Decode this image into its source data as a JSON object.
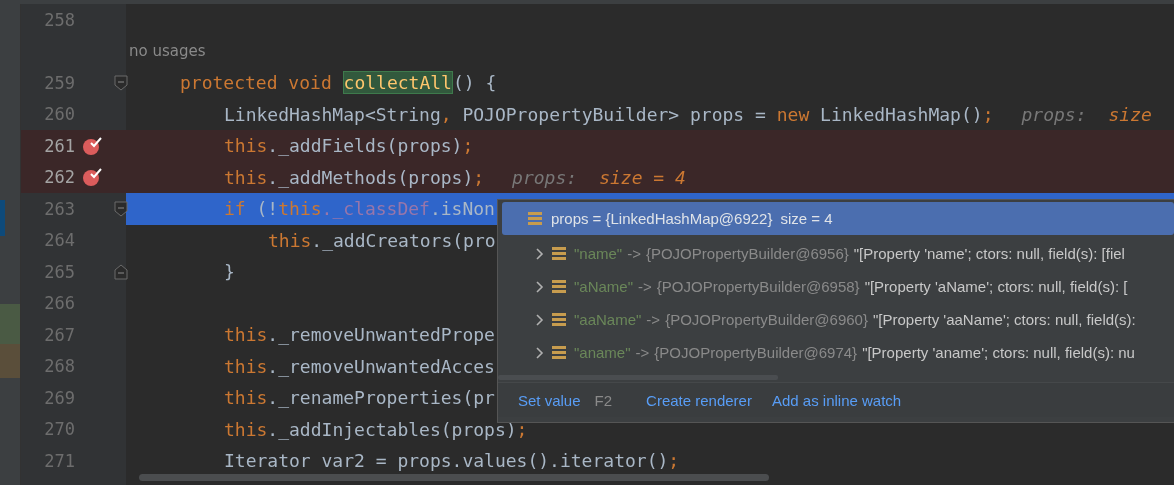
{
  "lines": [
    {
      "number": "258"
    },
    {
      "kind": "usage-hint",
      "text": "no usages"
    },
    {
      "number": "259",
      "fold_start": true,
      "tokens": [
        {
          "kind": "kw",
          "s": "protected void "
        },
        {
          "kind": "match",
          "s": "collectAll"
        },
        {
          "kind": "plain",
          "s": "() {"
        }
      ],
      "children": [
        {
          "number": "260",
          "tokens": [
            {
              "kind": "plain",
              "s": "LinkedHashMap<String"
            },
            {
              "kind": "kw",
              "s": ", "
            },
            {
              "kind": "plain",
              "s": "POJOPropertyBuilder> props = "
            },
            {
              "kind": "kw",
              "s": "new "
            },
            {
              "kind": "plain",
              "s": "LinkedHashMap()"
            },
            {
              "kind": "kw",
              "s": ";"
            },
            {
              "kind": "hint",
              "s": "props:"
            },
            {
              "kind": "hint-value",
              "s": "size"
            }
          ]
        },
        {
          "number": "261",
          "breakpoint": true,
          "tokens": [
            {
              "kind": "kw",
              "s": "this"
            },
            {
              "kind": "plain",
              "s": "._addFields(props)"
            },
            {
              "kind": "kw",
              "s": ";"
            }
          ]
        },
        {
          "number": "262",
          "breakpoint": true,
          "tokens": [
            {
              "kind": "kw",
              "s": "this"
            },
            {
              "kind": "plain",
              "s": "._addMethods(props)"
            },
            {
              "kind": "kw",
              "s": ";"
            },
            {
              "kind": "hint",
              "s": "props:"
            },
            {
              "kind": "hint-value",
              "s": "size = 4"
            }
          ]
        },
        {
          "number": "263",
          "current": true,
          "fold_start": true,
          "tokens": [
            {
              "kind": "kw",
              "s": "if "
            },
            {
              "kind": "plain",
              "s": "(!"
            },
            {
              "kind": "kw",
              "s": "this"
            },
            {
              "kind": "field",
              "s": "._classDef"
            },
            {
              "kind": "plain",
              "s": ".isNon"
            }
          ],
          "children": [
            {
              "number": "264",
              "tokens": [
                {
                  "kind": "kw",
                  "s": "this"
                },
                {
                  "kind": "plain",
                  "s": "._addCreators(pro"
                }
              ]
            }
          ]
        },
        {
          "number": "265",
          "fold_end": true,
          "tokens": [
            {
              "kind": "plain",
              "s": "}"
            }
          ]
        },
        {
          "number": "266"
        },
        {
          "number": "267",
          "tokens": [
            {
              "kind": "kw",
              "s": "this"
            },
            {
              "kind": "plain",
              "s": "._removeUnwantedPrope"
            }
          ]
        },
        {
          "number": "268",
          "tokens": [
            {
              "kind": "kw",
              "s": "this"
            },
            {
              "kind": "plain",
              "s": "._removeUnwantedAcces"
            }
          ]
        },
        {
          "number": "269",
          "tokens": [
            {
              "kind": "kw",
              "s": "this"
            },
            {
              "kind": "plain",
              "s": "._renameProperties(pr"
            }
          ]
        },
        {
          "number": "270",
          "tokens": [
            {
              "kind": "kw",
              "s": "this"
            },
            {
              "kind": "plain",
              "s": "._addInjectables(props)"
            },
            {
              "kind": "kw",
              "s": ";"
            }
          ]
        },
        {
          "number": "271",
          "tokens": [
            {
              "kind": "plain",
              "s": "Iterator var2 = props.values().iterator()"
            },
            {
              "kind": "kw",
              "s": ";"
            }
          ]
        }
      ]
    }
  ],
  "popup": {
    "header": {
      "name": "props",
      "value": "= {LinkedHashMap@6922}",
      "size": "size = 4",
      "selected": true
    },
    "entries": [
      {
        "key": "\"name\"",
        "arrow": "->",
        "type": "{POJOPropertyBuilder@6956}",
        "value": "\"[Property 'name'; ctors: null, field(s): [fiel",
        "expanded": false,
        "selected": false
      },
      {
        "key": "\"aName\"",
        "arrow": "->",
        "type": "{POJOPropertyBuilder@6958}",
        "value": "\"[Property 'aName'; ctors: null, field(s): [",
        "expanded": false,
        "selected": false
      },
      {
        "key": "\"aaName\"",
        "arrow": "->",
        "type": "{POJOPropertyBuilder@6960}",
        "value": "\"[Property 'aaName'; ctors: null, field(s):",
        "expanded": false,
        "selected": false
      },
      {
        "key": "\"aname\"",
        "arrow": "->",
        "type": "{POJOPropertyBuilder@6974}",
        "value": "\"[Property 'aname'; ctors: null, field(s): nu",
        "expanded": false,
        "selected": false
      }
    ],
    "actions": [
      {
        "label": "Set value",
        "shortcut": "F2"
      },
      {
        "label": "Create renderer"
      },
      {
        "label": "Add as inline watch"
      }
    ]
  }
}
